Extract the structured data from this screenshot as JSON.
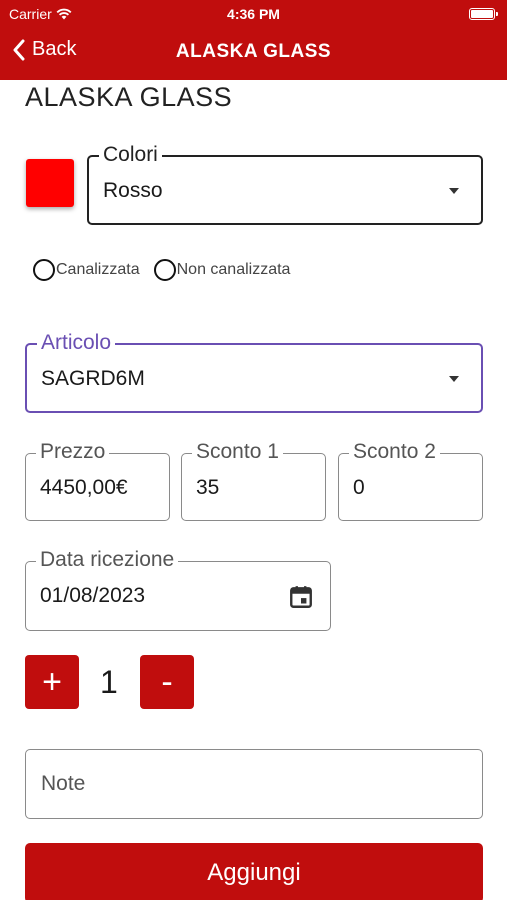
{
  "status_bar": {
    "carrier": "Carrier",
    "time": "4:36 PM"
  },
  "nav": {
    "back_label": "Back",
    "title": "ALASKA GLASS"
  },
  "page_title": "ALASKA GLASS",
  "colori": {
    "label": "Colori",
    "value": "Rosso",
    "swatch_color": "#ff0000"
  },
  "radios": [
    {
      "label": "Canalizzata",
      "checked": false
    },
    {
      "label": "Non canalizzata",
      "checked": false
    }
  ],
  "articolo": {
    "label": "Articolo",
    "value": "SAGRD6M",
    "focus_color": "#6a4fb3"
  },
  "prezzo": {
    "label": "Prezzo",
    "value": "4450,00€"
  },
  "sconto1": {
    "label": "Sconto 1",
    "value": "35"
  },
  "sconto2": {
    "label": "Sconto 2",
    "value": "0"
  },
  "data_ricezione": {
    "label": "Data ricezione",
    "value": "01/08/2023"
  },
  "quantity": {
    "plus": "+",
    "value": "1",
    "minus": "-"
  },
  "note": {
    "placeholder": "Note"
  },
  "add_button": {
    "label": "Aggiungi"
  },
  "accent_color": "#c00d0d"
}
